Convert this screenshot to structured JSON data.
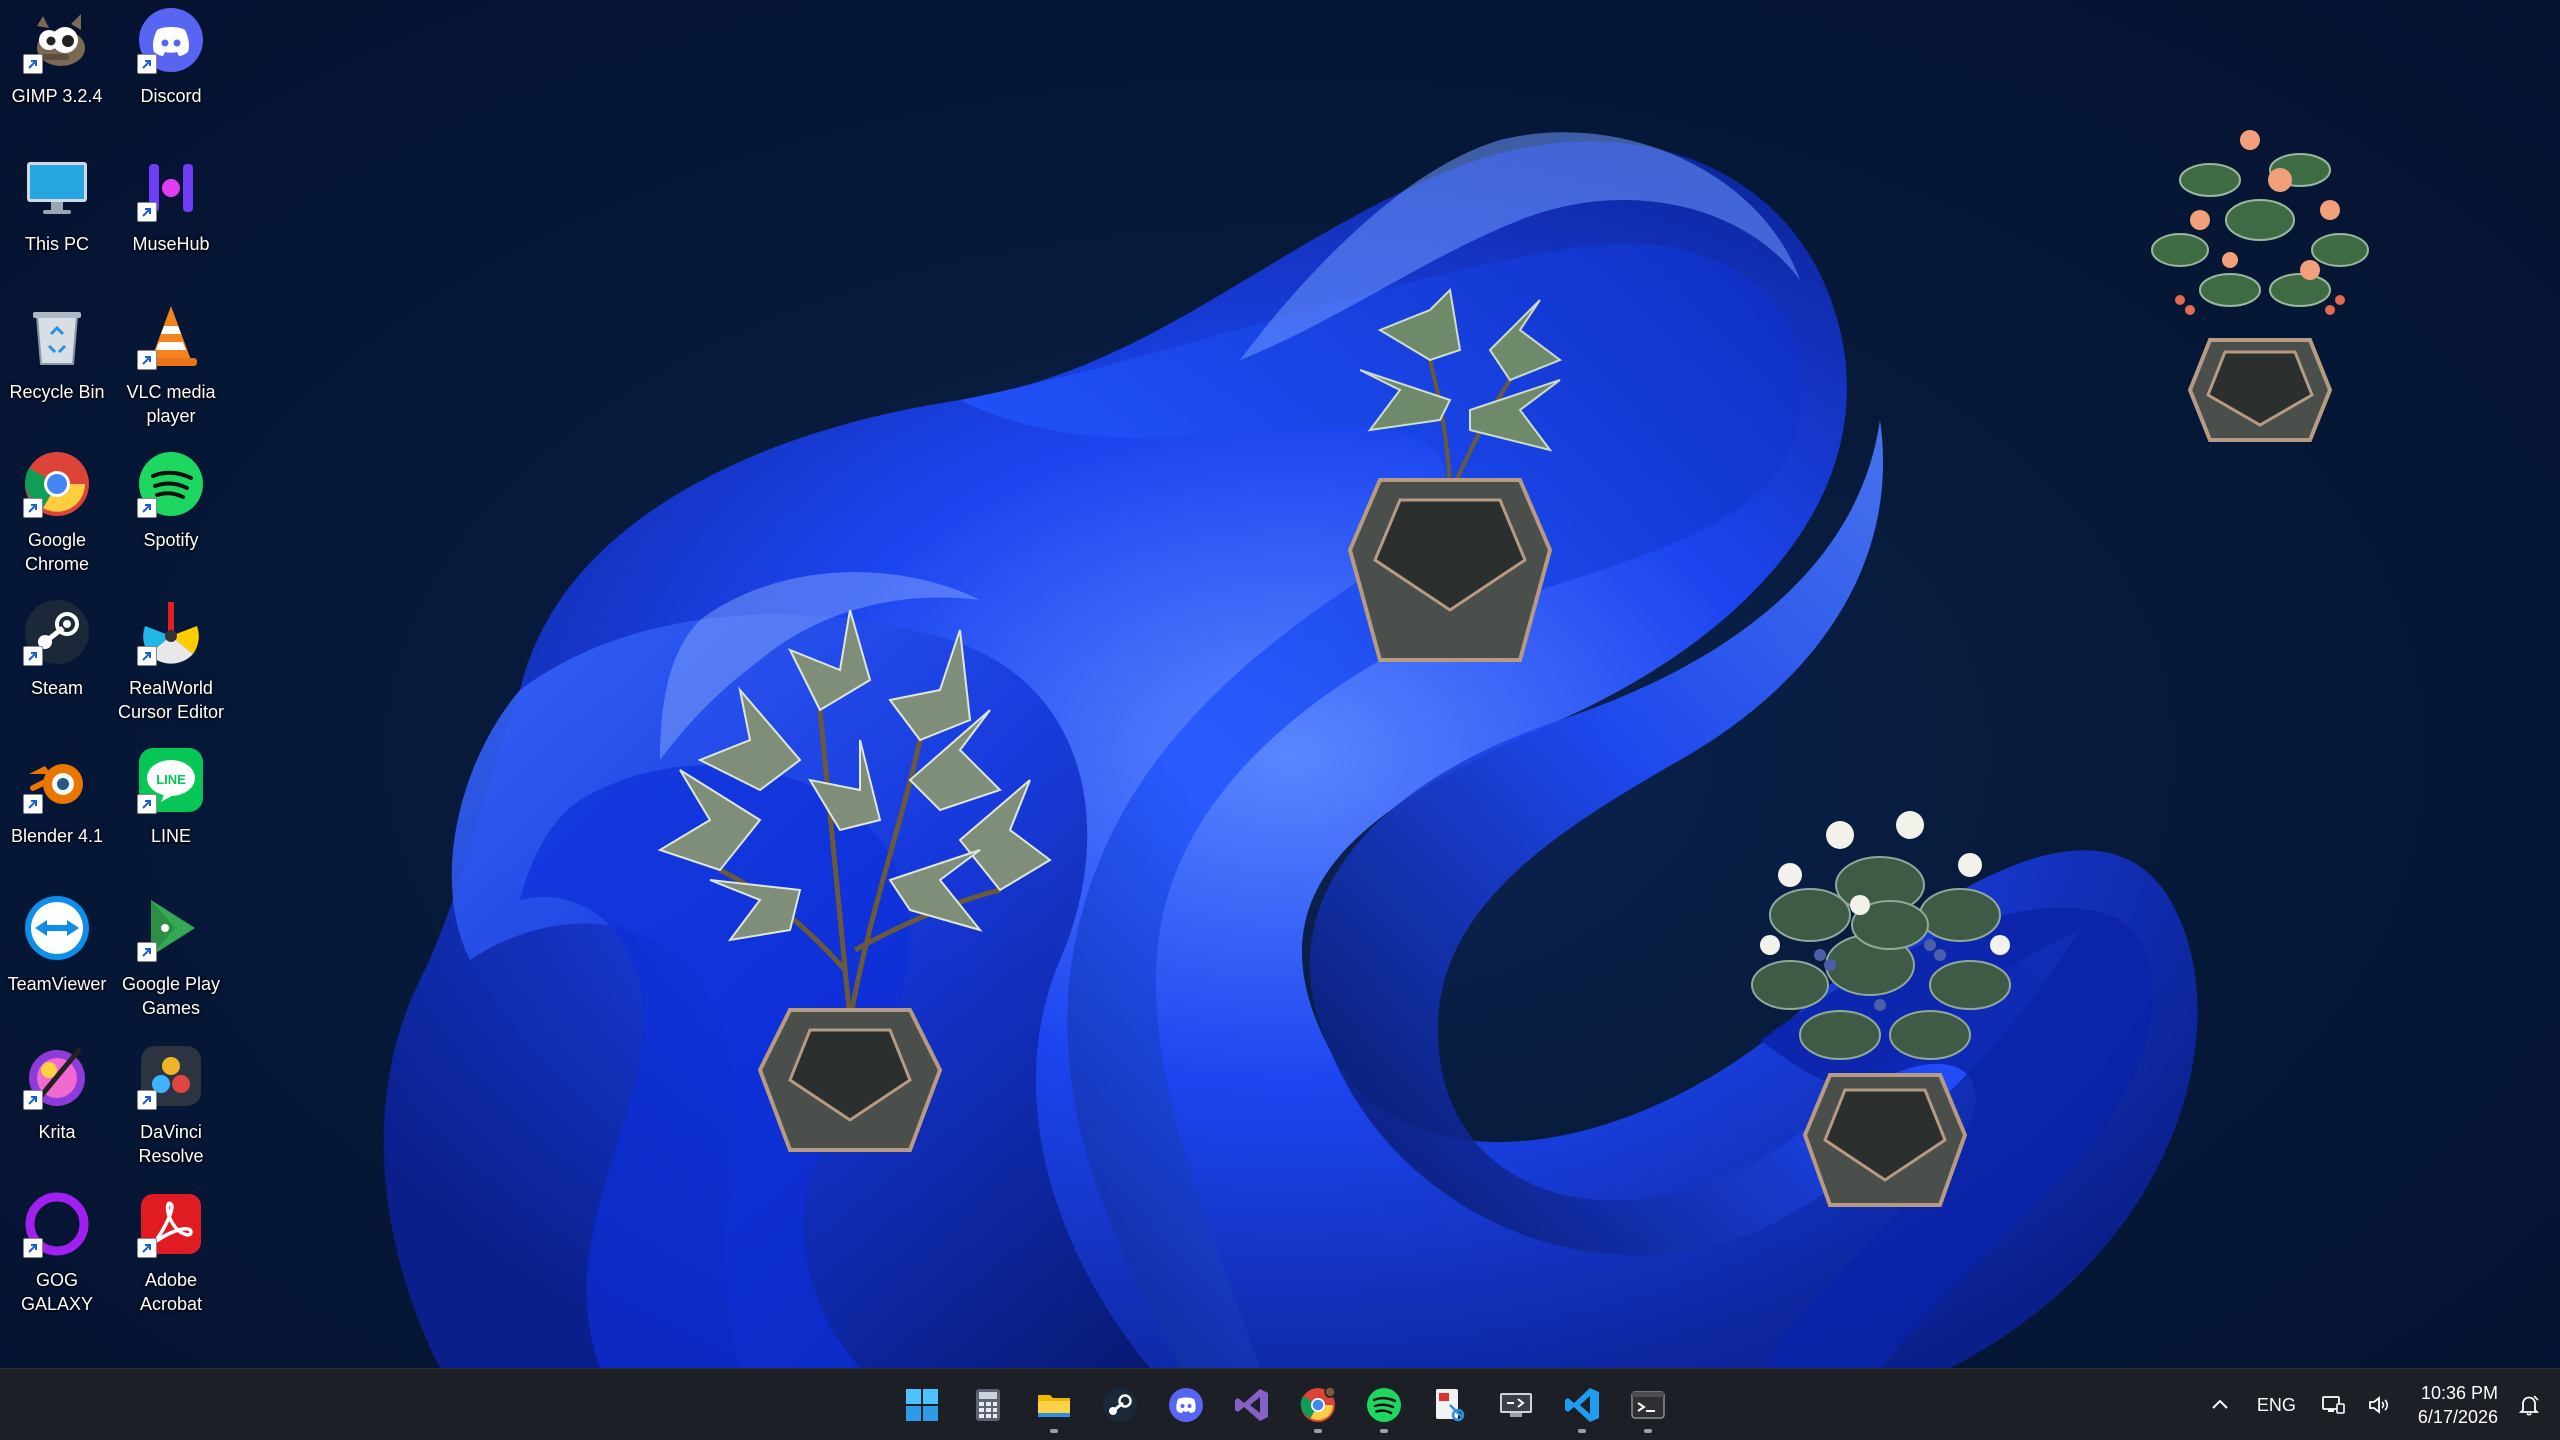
{
  "desktop": {
    "icons": [
      {
        "label": "GIMP 3.2.4",
        "icon": "gimp-icon"
      },
      {
        "label": "Discord",
        "icon": "discord-icon"
      },
      {
        "label": "This PC",
        "icon": "monitor-icon"
      },
      {
        "label": "MuseHub",
        "icon": "musehub-icon"
      },
      {
        "label": "Recycle Bin",
        "icon": "recycle-bin-icon"
      },
      {
        "label": "VLC media player",
        "icon": "vlc-cone-icon"
      },
      {
        "label": "Google Chrome",
        "icon": "chrome-icon"
      },
      {
        "label": "Spotify",
        "icon": "spotify-icon"
      },
      {
        "label": "Steam",
        "icon": "steam-icon"
      },
      {
        "label": "RealWorld Cursor Editor",
        "icon": "realworld-icon"
      },
      {
        "label": "Blender 4.1",
        "icon": "blender-icon"
      },
      {
        "label": "LINE",
        "icon": "line-icon"
      },
      {
        "label": "TeamViewer",
        "icon": "teamviewer-icon"
      },
      {
        "label": "Google Play Games",
        "icon": "play-games-icon"
      },
      {
        "label": "Krita",
        "icon": "krita-icon"
      },
      {
        "label": "DaVinci Resolve",
        "icon": "davinci-icon"
      },
      {
        "label": "GOG GALAXY",
        "icon": "gog-galaxy-icon"
      },
      {
        "label": "Adobe Acrobat",
        "icon": "acrobat-icon"
      }
    ],
    "widgets": [
      "potted-plant-large",
      "potted-plant-small",
      "potted-plant-flowering-white",
      "potted-plant-flowering-pink"
    ]
  },
  "taskbar": {
    "apps": [
      {
        "icon": "windows-start-icon",
        "running": false
      },
      {
        "icon": "calculator-icon",
        "running": false
      },
      {
        "icon": "file-explorer-icon",
        "running": true
      },
      {
        "icon": "steam-icon",
        "running": false
      },
      {
        "icon": "discord-icon",
        "running": false
      },
      {
        "icon": "visual-studio-icon",
        "running": false
      },
      {
        "icon": "chrome-icon",
        "running": true
      },
      {
        "icon": "spotify-icon",
        "running": true
      },
      {
        "icon": "snipping-tool-icon",
        "running": false
      },
      {
        "icon": "remote-desktop-icon",
        "running": false
      },
      {
        "icon": "vscode-icon",
        "running": true
      },
      {
        "icon": "terminal-icon",
        "running": true
      }
    ],
    "tray": {
      "language": "ENG",
      "time": "10:36 PM",
      "date": "6/17/2026"
    }
  },
  "colors": {
    "taskbar_bg": "#1c1f26",
    "wallpaper_blue": "#1f49ff",
    "accent": "#0067c0"
  }
}
